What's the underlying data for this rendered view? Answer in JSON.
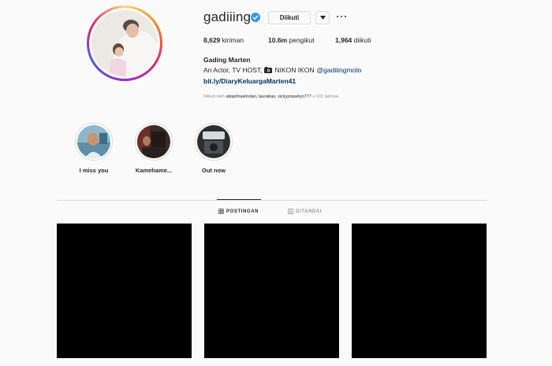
{
  "profile": {
    "username": "gadiiing",
    "verified": true,
    "follow_button_label": "Diikuti",
    "dropdown_icon": "chevron-down-icon",
    "more_icon": "ellipsis-icon",
    "stats": {
      "posts_count": "8,629",
      "posts_label": "kiriman",
      "followers_count": "10.6m",
      "followers_label": "pengikut",
      "following_count": "1,964",
      "following_label": "diikuti"
    },
    "full_name": "Gading Marten",
    "bio_text": "An Actor, TV HOST,",
    "bio_icon": "camera-icon",
    "bio_text_2": "NIKON IKON",
    "bio_mention": "@gadiiingmoto",
    "bio_link": "bit.ly/DiaryKeluargaMarten41",
    "followed_by_prefix": "Diikuti oleh",
    "followed_by_names": "atiqahhasiholan, laurabas, vickyprasetyo777",
    "followed_by_suffix": "+ 101 lainnya"
  },
  "highlights": [
    {
      "label": "I miss you"
    },
    {
      "label": "Kamehame..."
    },
    {
      "label": "Out now"
    }
  ],
  "tabs": [
    {
      "label": "POSTINGAN",
      "icon": "grid-icon",
      "active": true
    },
    {
      "label": "DITANDAI",
      "icon": "tag-icon",
      "active": false
    }
  ],
  "colors": {
    "background": "#fafafa",
    "link": "#003569",
    "verified_badge": "#3897f0",
    "muted": "#8e8e8e"
  }
}
